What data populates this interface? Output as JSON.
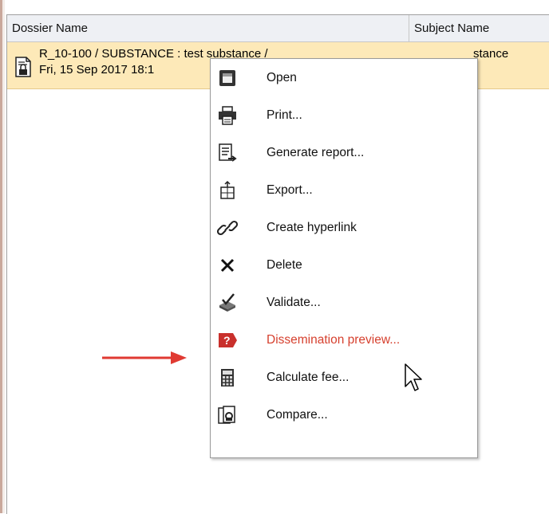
{
  "table": {
    "columns": [
      "Dossier Name",
      "Subject Name"
    ],
    "row": {
      "line1": "R_10-100 / SUBSTANCE : test substance /",
      "line2": "Fri, 15 Sep 2017 18:1",
      "subject": "stance"
    }
  },
  "context_menu": {
    "items": [
      {
        "label": "Open",
        "icon": "open-icon"
      },
      {
        "label": "Print...",
        "icon": "printer-icon"
      },
      {
        "label": "Generate report...",
        "icon": "report-icon"
      },
      {
        "label": "Export...",
        "icon": "export-icon"
      },
      {
        "label": "Create hyperlink",
        "icon": "link-icon"
      },
      {
        "label": "Delete",
        "icon": "delete-icon"
      },
      {
        "label": "Validate...",
        "icon": "validate-icon"
      },
      {
        "label": "Dissemination preview...",
        "icon": "help-question-icon",
        "highlighted": true
      },
      {
        "label": "Calculate fee...",
        "icon": "calculator-icon"
      },
      {
        "label": "Compare...",
        "icon": "compare-icon"
      }
    ]
  },
  "colors": {
    "row_selected": "#fde9b8",
    "highlight_text": "#d6402e",
    "annotation_arrow": "#e03a32"
  }
}
